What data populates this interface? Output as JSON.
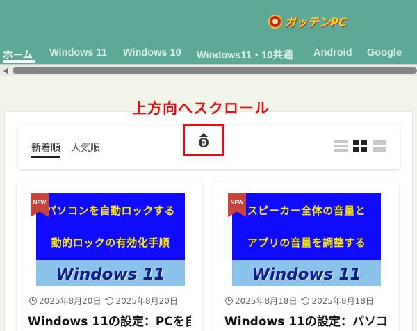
{
  "header": {
    "logo_text": "ガッテンPC"
  },
  "nav": {
    "items": [
      {
        "label": "ホーム"
      },
      {
        "label": "Windows 11"
      },
      {
        "label": "Windows 10"
      },
      {
        "label": "Windows11・10共通"
      },
      {
        "label": "Android"
      },
      {
        "label": "Google"
      }
    ]
  },
  "annotation": {
    "text": "上方向へスクロール"
  },
  "sort_tabs": {
    "newest": "新着順",
    "popular": "人気順"
  },
  "icons": {
    "scroll_up": "scroll-up-icon",
    "view_list": "list-view-icon",
    "view_grid": "grid-view-icon",
    "view_rows": "rows-view-icon",
    "clock": "clock-icon",
    "update": "update-icon"
  },
  "colors": {
    "header_bg": "#5ea898",
    "annotation": "#e60d12",
    "thumb_bg": "#0e0bff",
    "thumb_text": "#ffea00",
    "thumb_band": "#8cc3ea",
    "badge": "#c8433a"
  },
  "articles": [
    {
      "badge": "NEW",
      "thumb_line1": "パソコンを自動ロックする",
      "thumb_line2": "動的ロックの有効化手順",
      "thumb_os": "Windows 11",
      "published": "2025年8月20日",
      "updated": "2025年8月20日",
      "title": "Windows 11の設定：PCを自"
    },
    {
      "badge": "NEW",
      "thumb_line1": "スピーカー全体の音量と",
      "thumb_line2": "アプリの音量を調整する",
      "thumb_os": "Windows 11",
      "published": "2025年8月18日",
      "updated": "2025年8月18日",
      "title": "Windows 11の設定：パソコ"
    }
  ]
}
